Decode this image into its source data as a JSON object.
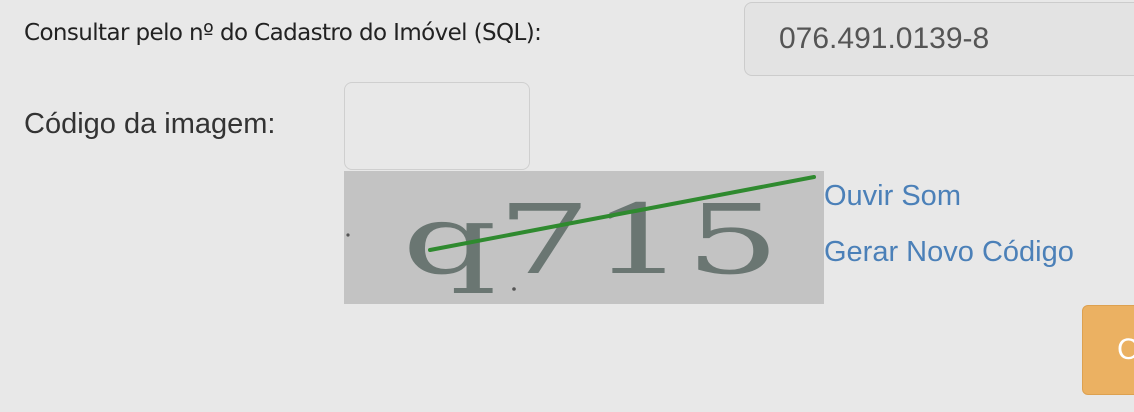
{
  "form": {
    "sql_label": "Consultar pelo nº do Cadastro do Imóvel (SQL):",
    "sql_value": "076.491.0139-8",
    "image_code_label": "Código da imagem:",
    "image_code_value": ""
  },
  "captcha": {
    "text": "q715"
  },
  "links": {
    "audio": "Ouvir Som",
    "new_code": "Gerar Novo Código"
  },
  "submit": {
    "label": "C",
    "color": "#ebb162"
  },
  "colors": {
    "background": "#e8e8e8",
    "link": "#4b80b8",
    "captcha_line": "#2f8a2f",
    "captcha_background": "#c3c3c3"
  }
}
